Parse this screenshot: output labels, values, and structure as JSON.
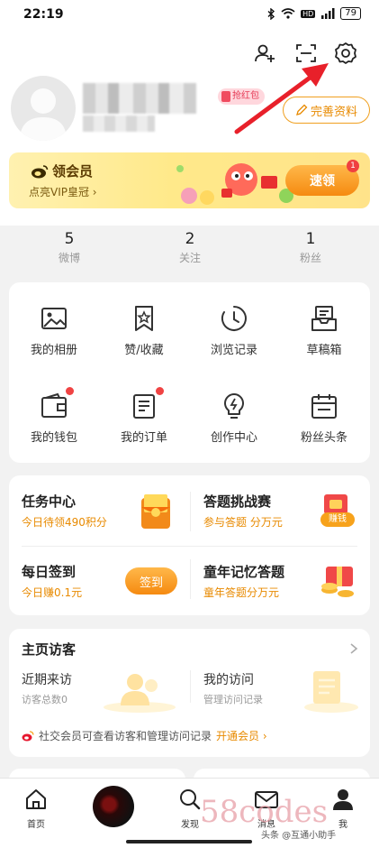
{
  "status_bar": {
    "time": "22:19",
    "battery": "79",
    "icons": [
      "bluetooth-icon",
      "wifi-icon",
      "hd-icon",
      "signal-icon",
      "battery-icon"
    ]
  },
  "header_icons": [
    "add-friend-icon",
    "scan-icon",
    "settings-icon"
  ],
  "profile": {
    "redpack_badge": "抢红包",
    "edit_button": "完善资料"
  },
  "vip_banner": {
    "title": "领会员",
    "subtitle": "点亮VIP皇冠 ›",
    "button": "速领",
    "badge_count": "1"
  },
  "stats": [
    {
      "count": "5",
      "label": "微博"
    },
    {
      "count": "2",
      "label": "关注"
    },
    {
      "count": "1",
      "label": "粉丝"
    }
  ],
  "grid": {
    "row1": [
      {
        "label": "我的相册",
        "icon": "photo-album-icon"
      },
      {
        "label": "赞/收藏",
        "icon": "bookmark-icon"
      },
      {
        "label": "浏览记录",
        "icon": "history-clock-icon"
      },
      {
        "label": "草稿箱",
        "icon": "drafts-tray-icon"
      }
    ],
    "row2": [
      {
        "label": "我的钱包",
        "icon": "wallet-icon",
        "dot": true
      },
      {
        "label": "我的订单",
        "icon": "order-list-icon",
        "dot": true
      },
      {
        "label": "创作中心",
        "icon": "creation-bulb-icon",
        "dot": false
      },
      {
        "label": "粉丝头条",
        "icon": "calendar-icon",
        "dot": false
      }
    ]
  },
  "tasks": {
    "task_center": {
      "title": "任务中心",
      "sub": "今日待领490积分"
    },
    "quiz": {
      "title": "答题挑战赛",
      "sub": "参与答题 分万元",
      "badge": "赚钱"
    },
    "checkin": {
      "title": "每日签到",
      "sub": "今日赚0.1元",
      "button": "签到"
    },
    "childhood": {
      "title": "童年记忆答题",
      "sub": "童年答题分万元"
    }
  },
  "visitors": {
    "title": "主页访客",
    "recent": {
      "title": "近期来访",
      "sub": "访客总数0"
    },
    "mine": {
      "title": "我的访问",
      "sub": "管理访问记录"
    },
    "promo": "社交会员可查看访客和管理访问记录",
    "promo_link": "开通会员 ›"
  },
  "bottom_nav": [
    {
      "label": "首页",
      "icon": "home-icon"
    },
    {
      "label": "",
      "icon": "video-avatar-icon"
    },
    {
      "label": "发现",
      "icon": "discover-search-icon"
    },
    {
      "label": "消息",
      "icon": "message-envelope-icon"
    },
    {
      "label": "我",
      "icon": "profile-person-icon"
    }
  ],
  "watermarks": {
    "big": "58codes",
    "small": "头条 @互通小助手"
  },
  "colors": {
    "accent_orange": "#f58a10",
    "annotation_red": "#e8202a",
    "vip_yellow": "#ffe98a",
    "red_dot": "#f04343"
  }
}
